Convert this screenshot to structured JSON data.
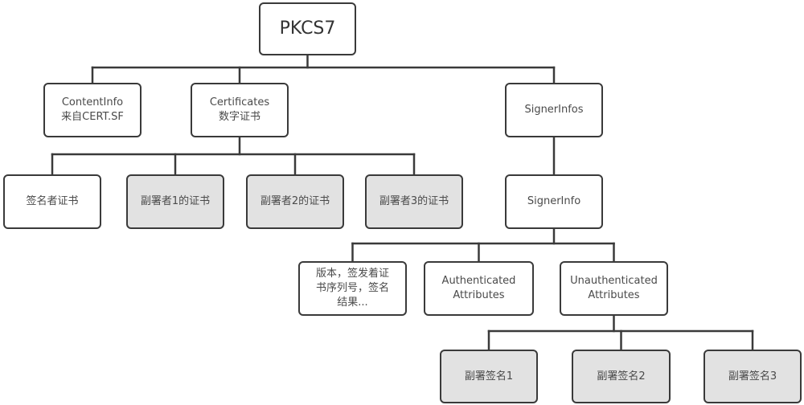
{
  "diagram": {
    "type": "tree",
    "colors": {
      "border": "#3a3a3a",
      "text": "#4a4a4a",
      "shaded_fill": "#e2e2e2",
      "plain_fill": "#ffffff"
    },
    "nodes": {
      "pkcs7": {
        "label": "PKCS7",
        "shaded": false
      },
      "contentinfo": {
        "label": "ContentInfo\n来自CERT.SF",
        "shaded": false
      },
      "certificates": {
        "label": "Certificates\n数字证书",
        "shaded": false
      },
      "signerinfos": {
        "label": "SignerInfos",
        "shaded": false
      },
      "signer_cert": {
        "label": "签名者证书",
        "shaded": false
      },
      "cosigner1_cert": {
        "label": "副署者1的证书",
        "shaded": true
      },
      "cosigner2_cert": {
        "label": "副署者2的证书",
        "shaded": true
      },
      "cosigner3_cert": {
        "label": "副署者3的证书",
        "shaded": true
      },
      "signerinfo": {
        "label": "SignerInfo",
        "shaded": false
      },
      "version_info": {
        "label": "版本，签发着证\n书序列号，签名\n结果...",
        "shaded": false
      },
      "auth_attrs": {
        "label": "Authenticated\nAttributes",
        "shaded": false
      },
      "unauth_attrs": {
        "label": "Unauthenticated\nAttributes",
        "shaded": false
      },
      "cosign1": {
        "label": "副署签名1",
        "shaded": true
      },
      "cosign2": {
        "label": "副署签名2",
        "shaded": true
      },
      "cosign3": {
        "label": "副署签名3",
        "shaded": true
      }
    },
    "edges": [
      [
        "pkcs7",
        "contentinfo"
      ],
      [
        "pkcs7",
        "certificates"
      ],
      [
        "pkcs7",
        "signerinfos"
      ],
      [
        "certificates",
        "signer_cert"
      ],
      [
        "certificates",
        "cosigner1_cert"
      ],
      [
        "certificates",
        "cosigner2_cert"
      ],
      [
        "certificates",
        "cosigner3_cert"
      ],
      [
        "signerinfos",
        "signerinfo"
      ],
      [
        "signerinfo",
        "version_info"
      ],
      [
        "signerinfo",
        "auth_attrs"
      ],
      [
        "signerinfo",
        "unauth_attrs"
      ],
      [
        "unauth_attrs",
        "cosign1"
      ],
      [
        "unauth_attrs",
        "cosign2"
      ],
      [
        "unauth_attrs",
        "cosign3"
      ]
    ]
  }
}
